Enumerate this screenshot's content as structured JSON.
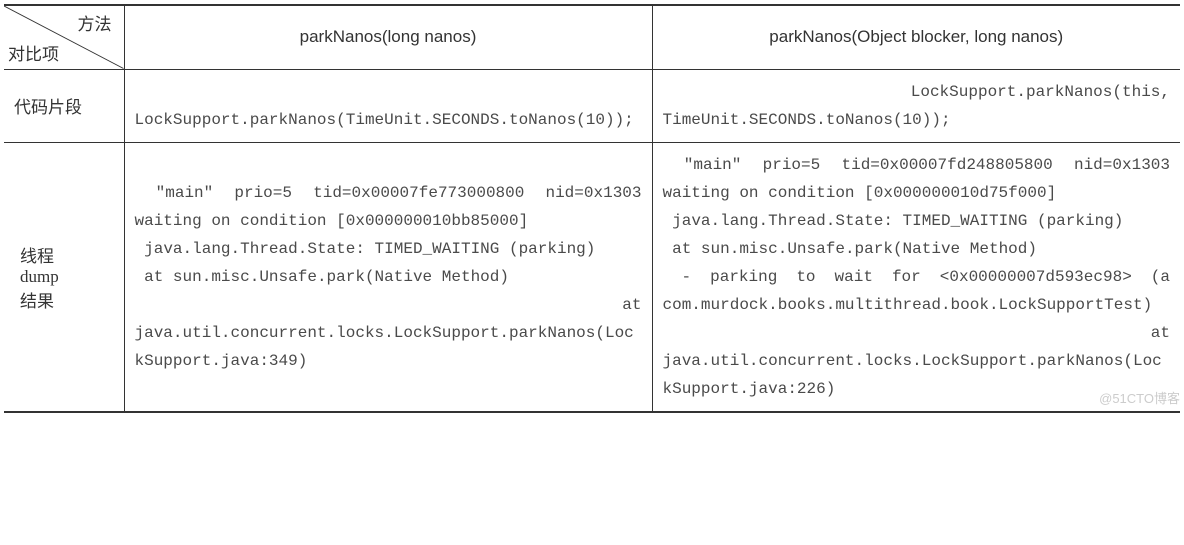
{
  "header": {
    "diag_top": "方法",
    "diag_bottom": "对比项",
    "col1": "parkNanos(long nanos)",
    "col2": "parkNanos(Object blocker, long nanos)"
  },
  "rows": {
    "r1_label": "代码片段",
    "r1_c1": " LockSupport.parkNanos(TimeUnit.SECONDS.toNanos(10));",
    "r1_c2": " LockSupport.parkNanos(this, TimeUnit.SECONDS.toNanos(10));",
    "r2_label_l1": "线程",
    "r2_label_l2": "dump",
    "r2_label_l3": "结果",
    "r2_c1": " \"main\" prio=5 tid=0x00007fe773000800 nid=0x1303 waiting on condition [0x000000010bb85000]\n java.lang.Thread.State: TIMED_WAITING (parking)\n at sun.misc.Unsafe.park(Native Method)\n at java.util.concurrent.locks.LockSupport.parkNanos(LockSupport.java:349)",
    "r2_c2": " \"main\" prio=5 tid=0x00007fd248805800 nid=0x1303 waiting on condition [0x000000010d75f000]\n java.lang.Thread.State: TIMED_WAITING (parking)\n at sun.misc.Unsafe.park(Native Method)\n - parking to wait for <0x00000007d593ec98> (a com.murdock.books.multithread.book.LockSupportTest)\n at java.util.concurrent.locks.LockSupport.parkNanos(LockSupport.java:226)"
  },
  "watermark": "@51CTO博客"
}
